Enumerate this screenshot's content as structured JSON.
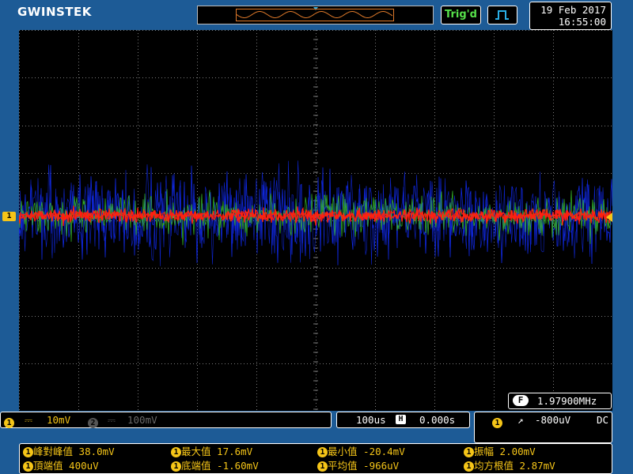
{
  "brand": "GWINSTEK",
  "trigger_status": "Trig'd",
  "datetime": {
    "date": "19 Feb 2017",
    "time": "16:55:00"
  },
  "channel_marker": "1",
  "frequency": {
    "badge": "F",
    "value": "1.97900MHz"
  },
  "channels": {
    "ch1": {
      "number": "1",
      "coupling_symbol": "⎓",
      "scale": "10mV"
    },
    "ch2": {
      "number": "2",
      "coupling_symbol": "⎓",
      "scale": "100mV"
    }
  },
  "timebase": {
    "scale": "100us",
    "position_icon": "H",
    "position": "0.000s"
  },
  "trigger": {
    "source": "1",
    "edge_symbol": "↗",
    "level": "-800uV",
    "coupling": "DC"
  },
  "measurements": [
    {
      "source": "1",
      "label": "峰對峰值",
      "value": "38.0mV"
    },
    {
      "source": "1",
      "label": "最大值",
      "value": "17.6mV"
    },
    {
      "source": "1",
      "label": "最小值",
      "value": "-20.4mV"
    },
    {
      "source": "1",
      "label": "振幅",
      "value": "2.00mV"
    },
    {
      "source": "1",
      "label": "頂端值",
      "value": "400uV"
    },
    {
      "source": "1",
      "label": "底端值",
      "value": "-1.60mV"
    },
    {
      "source": "1",
      "label": "平均值",
      "value": "-966uV"
    },
    {
      "source": "1",
      "label": "均方根值",
      "value": "2.87mV"
    }
  ],
  "colors": {
    "background": "#1d5b96",
    "ch1": "#f5c518",
    "trace_persist_blue": "#1028e0",
    "trace_persist_green": "#38c02a",
    "trace_current": "#ff2010",
    "grid": "#7a7a7a"
  }
}
